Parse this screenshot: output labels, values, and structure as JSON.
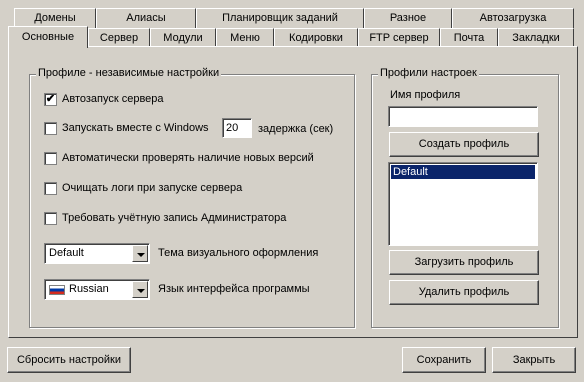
{
  "tabs_row1": [
    "Домены",
    "Алиасы",
    "Планировщик заданий",
    "Разное",
    "Автозагрузка"
  ],
  "tabs_row2": [
    "Основные",
    "Сервер",
    "Модули",
    "Меню",
    "Кодировки",
    "FTP сервер",
    "Почта",
    "Закладки"
  ],
  "active_tab": "Основные",
  "profile_independent": {
    "legend": "Профиле - независимые настройки",
    "autostart": {
      "label": "Автозапуск сервера",
      "checked": true
    },
    "start_with_windows": {
      "label": "Запускать вместе с Windows",
      "checked": false,
      "delay_value": "20",
      "delay_label": "задержка (сек)"
    },
    "check_updates": {
      "label": "Автоматически проверять наличие новых версий",
      "checked": false
    },
    "clear_logs": {
      "label": "Очищать логи при запуске сервера",
      "checked": false
    },
    "require_admin": {
      "label": "Требовать учётную запись Администратора",
      "checked": false
    },
    "theme": {
      "value": "Default",
      "label": "Тема визуального оформления"
    },
    "language": {
      "value": "Russian",
      "label": "Язык интерфейса программы",
      "flag_colors": [
        "#ffffff",
        "#0039a6",
        "#d52b1e"
      ]
    }
  },
  "profiles": {
    "legend": "Профили настроек",
    "name_label": "Имя профиля",
    "name_value": "",
    "create_button": "Создать профиль",
    "list": [
      "Default"
    ],
    "selected": "Default",
    "load_button": "Загрузить профиль",
    "delete_button": "Удалить профиль"
  },
  "footer": {
    "reset": "Сбросить настройки",
    "save": "Сохранить",
    "close": "Закрыть"
  },
  "colors": {
    "face": "#d4d0c8",
    "selection": "#0a246a"
  }
}
